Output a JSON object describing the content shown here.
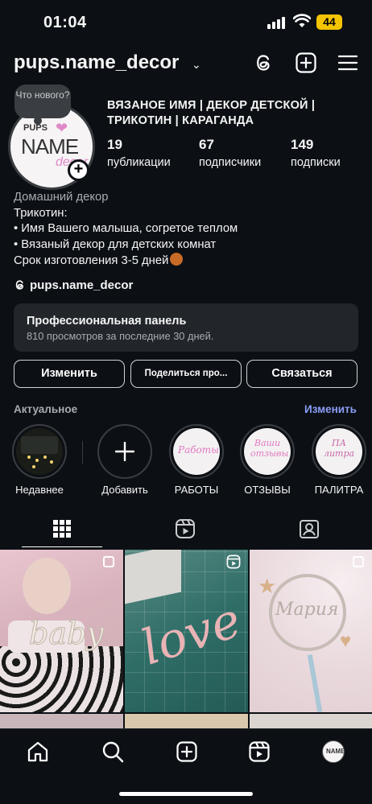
{
  "status_bar": {
    "time": "01:04",
    "battery": "44"
  },
  "header": {
    "username": "pups.name_decor"
  },
  "note": {
    "text": "Что нового?"
  },
  "profile": {
    "avatar_text": {
      "pups": "PUPS",
      "name": "NAME",
      "decor": "decor"
    },
    "display_name": "ВЯЗАНОЕ ИМЯ | ДЕКОР ДЕТСКОЙ | ТРИКОТИН | КАРАГАНДА",
    "stats": [
      {
        "value": "19",
        "label": "публикации"
      },
      {
        "value": "67",
        "label": "подписчики"
      },
      {
        "value": "149",
        "label": "подписки"
      }
    ],
    "bio": {
      "category": "Домашний декор",
      "lines": [
        "Трикотин:",
        "• Имя Вашего малыша, согретое теплом",
        "• Вязаный декор для детских комнат",
        "Срок изготовления 3-5 дней"
      ]
    },
    "threads_handle": "pups.name_decor"
  },
  "pro_panel": {
    "title": "Профессиональная панель",
    "subtitle": "810 просмотров за последние 30 дней."
  },
  "buttons": {
    "edit": "Изменить",
    "share": "Поделиться про...",
    "contact": "Связаться"
  },
  "highlights": {
    "heading": "Актуальное",
    "edit_link": "Изменить",
    "items": [
      {
        "label": "Недавнее"
      },
      {
        "label": "Добавить"
      },
      {
        "label": "РАБОТЫ",
        "cover_text": "Работы"
      },
      {
        "label": "ОТЗЫВЫ",
        "cover_text": "Ваши отзывы"
      },
      {
        "label": "ПАЛИТРА",
        "cover_text": "ПА литра"
      }
    ]
  },
  "grid_posts": [
    {
      "caption": "baby"
    },
    {
      "caption": "love"
    },
    {
      "caption": "Мария"
    }
  ],
  "colors": {
    "background": "#0c1014",
    "panel": "#22262b",
    "link": "#8b9cf7",
    "text": "#f5f5f5",
    "muted": "#a8acb0"
  },
  "icons": {
    "header": [
      "threads-icon",
      "add-post-icon",
      "menu-icon"
    ],
    "tabs": [
      "grid-icon",
      "reels-icon",
      "tagged-icon"
    ],
    "nav": [
      "home-icon",
      "search-icon",
      "create-icon",
      "reels-icon",
      "profile-avatar"
    ]
  }
}
